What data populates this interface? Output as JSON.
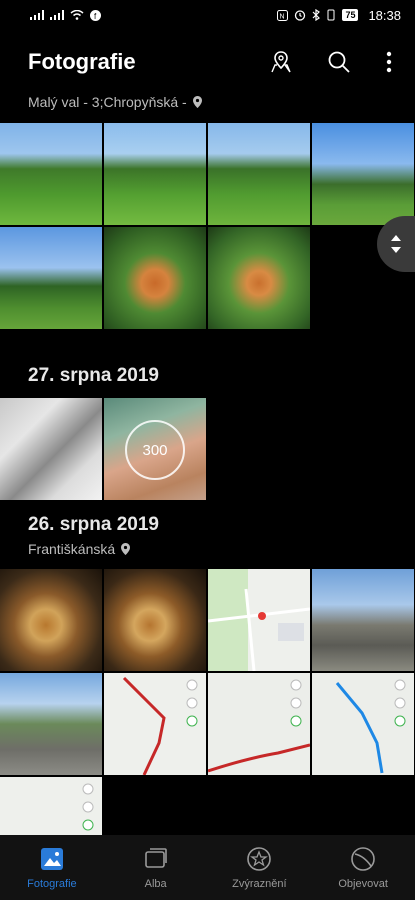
{
  "status": {
    "battery": "75",
    "time": "18:38"
  },
  "header": {
    "title": "Fotografie"
  },
  "location1": "Malý val - 3;Chropyňská -",
  "section1_date": "27. srpna 2019",
  "section2_date": "26. srpna 2019",
  "location2": "Františkánská",
  "ring_value": "300",
  "tabs": [
    {
      "label": "Fotografie",
      "icon": "photo-icon",
      "active": true
    },
    {
      "label": "Alba",
      "icon": "album-icon",
      "active": false
    },
    {
      "label": "Zvýraznění",
      "icon": "highlights-icon",
      "active": false
    },
    {
      "label": "Objevovat",
      "icon": "discover-icon",
      "active": false
    }
  ],
  "colors": {
    "accent": "#2a7bd8"
  }
}
